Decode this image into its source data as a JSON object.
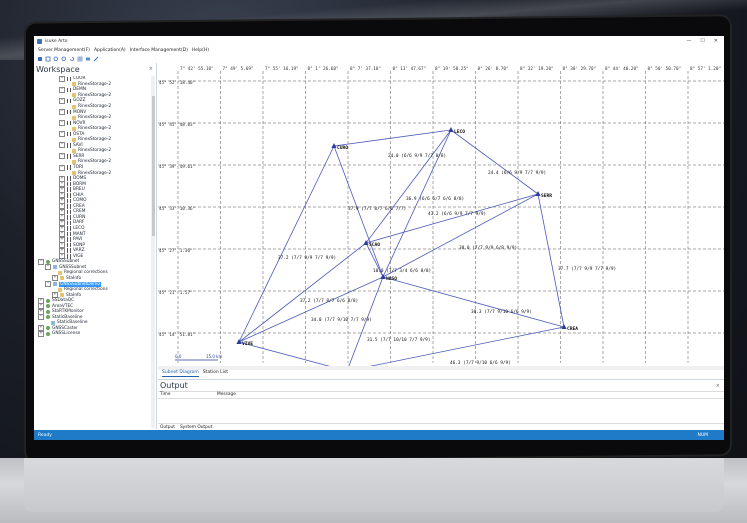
{
  "window": {
    "title": "isuke Arto",
    "min": "—",
    "max": "☐",
    "close": "✕"
  },
  "menu": [
    "Server Management(F)",
    "Application(A)",
    "Interface Management(D)",
    "Help(H)"
  ],
  "toolbar_icons": [
    "new-icon",
    "fit-icon",
    "zoom-in-icon",
    "zoom-out-icon",
    "refresh-icon",
    "grid-icon",
    "export-icon",
    "pen-icon"
  ],
  "workspace": {
    "title": "Workspace",
    "close": "×",
    "tree": [
      {
        "indent": 3,
        "kind": "station",
        "exp": "⊟",
        "label": "CUOR"
      },
      {
        "indent": 4,
        "kind": "leaf",
        "exp": "",
        "label": "RinexStorage-2"
      },
      {
        "indent": 3,
        "kind": "station",
        "exp": "⊟",
        "label": "DEMN"
      },
      {
        "indent": 4,
        "kind": "leaf",
        "exp": "",
        "label": "RinexStorage-2"
      },
      {
        "indent": 3,
        "kind": "station",
        "exp": "⊟",
        "label": "GOZZ"
      },
      {
        "indent": 4,
        "kind": "leaf",
        "exp": "",
        "label": "RinexStorage-2"
      },
      {
        "indent": 3,
        "kind": "station",
        "exp": "⊟",
        "label": "MONV"
      },
      {
        "indent": 4,
        "kind": "leaf",
        "exp": "",
        "label": "RinexStorage-2"
      },
      {
        "indent": 3,
        "kind": "station",
        "exp": "⊟",
        "label": "NOVR"
      },
      {
        "indent": 4,
        "kind": "leaf",
        "exp": "",
        "label": "RinexStorage-2"
      },
      {
        "indent": 3,
        "kind": "station",
        "exp": "⊟",
        "label": "OSTA"
      },
      {
        "indent": 4,
        "kind": "leaf",
        "exp": "",
        "label": "RinexStorage-2"
      },
      {
        "indent": 3,
        "kind": "station",
        "exp": "⊟",
        "label": "SAVI"
      },
      {
        "indent": 4,
        "kind": "leaf",
        "exp": "",
        "label": "RinexStorage-2"
      },
      {
        "indent": 3,
        "kind": "station",
        "exp": "⊟",
        "label": "SERR"
      },
      {
        "indent": 4,
        "kind": "leaf",
        "exp": "",
        "label": "RinexStorage-2"
      },
      {
        "indent": 3,
        "kind": "station",
        "exp": "⊟",
        "label": "TORI"
      },
      {
        "indent": 4,
        "kind": "leaf",
        "exp": "",
        "label": "RinexStorage-2"
      },
      {
        "indent": 3,
        "kind": "station",
        "exp": "⊞",
        "label": "DOMS"
      },
      {
        "indent": 3,
        "kind": "station",
        "exp": "⊞",
        "label": "BORM"
      },
      {
        "indent": 3,
        "kind": "station",
        "exp": "⊞",
        "label": "BREU"
      },
      {
        "indent": 3,
        "kind": "station",
        "exp": "⊞",
        "label": "CHIA"
      },
      {
        "indent": 3,
        "kind": "station",
        "exp": "⊞",
        "label": "COMO"
      },
      {
        "indent": 3,
        "kind": "station",
        "exp": "⊞",
        "label": "CREA"
      },
      {
        "indent": 3,
        "kind": "station",
        "exp": "⊞",
        "label": "CREM"
      },
      {
        "indent": 3,
        "kind": "station",
        "exp": "⊞",
        "label": "CURN"
      },
      {
        "indent": 3,
        "kind": "station",
        "exp": "⊞",
        "label": "DARF"
      },
      {
        "indent": 3,
        "kind": "station",
        "exp": "⊞",
        "label": "LECO"
      },
      {
        "indent": 3,
        "kind": "station",
        "exp": "⊞",
        "label": "MANT"
      },
      {
        "indent": 3,
        "kind": "station",
        "exp": "⊞",
        "label": "PAVI"
      },
      {
        "indent": 3,
        "kind": "station",
        "exp": "⊞",
        "label": "SONP"
      },
      {
        "indent": 3,
        "kind": "station",
        "exp": "⊞",
        "label": "VARZ"
      },
      {
        "indent": 3,
        "kind": "station",
        "exp": "⊞",
        "label": "VIGE"
      },
      {
        "indent": 0,
        "kind": "cloud",
        "exp": "⊟",
        "label": "GNSSSubnet"
      },
      {
        "indent": 1,
        "kind": "sub",
        "exp": "⊟",
        "label": "GNSSSubnet"
      },
      {
        "indent": 2,
        "kind": "leaf",
        "exp": "",
        "label": "Regional corrections"
      },
      {
        "indent": 2,
        "kind": "leaf",
        "exp": "⊞",
        "label": "StaInfo"
      },
      {
        "indent": 1,
        "kind": "sub",
        "exp": "⊟",
        "label": "GNSSSubnetDemo",
        "selected": true
      },
      {
        "indent": 2,
        "kind": "leaf",
        "exp": "",
        "label": "Regional corrections"
      },
      {
        "indent": 2,
        "kind": "leaf",
        "exp": "⊞",
        "label": "StaInfo"
      },
      {
        "indent": 0,
        "kind": "cloud",
        "exp": "⊞",
        "label": "SSDataQC"
      },
      {
        "indent": 0,
        "kind": "cloud",
        "exp": "⊞",
        "label": "AreaVTEC"
      },
      {
        "indent": 0,
        "kind": "cloud",
        "exp": "⊞",
        "label": "StaRTKMonitor"
      },
      {
        "indent": 0,
        "kind": "cloud",
        "exp": "⊟",
        "label": "StaticBaseline"
      },
      {
        "indent": 1,
        "kind": "sub",
        "exp": "",
        "label": "StaticBaseline"
      },
      {
        "indent": 0,
        "kind": "cloud",
        "exp": "⊞",
        "label": "GNSSCaster"
      },
      {
        "indent": 0,
        "kind": "cloud",
        "exp": "⊞",
        "label": "GNSSLicense"
      }
    ]
  },
  "diagram": {
    "lon_labels": [
      "7° 42' 55.10\"",
      "7° 49' 5.69\"",
      "7° 55' 16.19\"",
      "8° 1' 26.68\"",
      "8° 7' 37.18\"",
      "8° 13' 47.67\"",
      "8° 19' 58.25\"",
      "8° 26' 8.70\"",
      "8° 32' 19.20\"",
      "8° 38' 29.70\"",
      "8° 44' 40.20\"",
      "8° 50' 50.70\"",
      "8° 57' 1.20\"",
      "9° 3' 1"
    ],
    "lat_labels": [
      "45° 52' 18.40\"",
      "45° 45' 48.83\"",
      "45° 39' 49.61\"",
      "45° 33' 10.36\"",
      "45° 27' 1.36\"",
      "45° 21' 1.57\"",
      "45° 14' 51.81\"",
      "45° 8' 8.06"
    ],
    "stations": [
      {
        "id": "CURO",
        "label": "CURO"
      },
      {
        "id": "LECO",
        "label": "LECO"
      },
      {
        "id": "SERR",
        "label": "SERR"
      },
      {
        "id": "SCAO",
        "label": "SCAO"
      },
      {
        "id": "NOSO",
        "label": "NOSO"
      },
      {
        "id": "CREA",
        "label": "CREA"
      },
      {
        "id": "VIVE",
        "label": "VIVE"
      },
      {
        "id": "PAVI",
        "label": "PAVI"
      }
    ],
    "baselines": [
      {
        "from": "CURO",
        "to": "LECO",
        "label": "24.0 (6/6 9/9 7/7 8/8)"
      },
      {
        "from": "LECO",
        "to": "SERR",
        "label": "24.4 (6/6 9/9 7/7 9/9)"
      },
      {
        "from": "LECO",
        "to": "SCAO",
        "label": "36.9 (6/6 6/7 6/6 8/8)"
      },
      {
        "from": "LECO",
        "to": "NOSO",
        "label": "43.2 (6/6 9/9 7/7 9/9)"
      },
      {
        "from": "CURO",
        "to": "NOSO",
        "label": "37.9 (7/7 8/7 6/6 7/7)"
      },
      {
        "from": "SERR",
        "to": "SCAO",
        "label": "38.0 (7/7 9/9 6/8 9/9)"
      },
      {
        "from": "SERR",
        "to": "CREA",
        "label": "37.7 (7/7 9/9 7/7 9/9)"
      },
      {
        "from": "CURO",
        "to": "VIVE",
        "label": "37.2 (7/7 9/9 7/7 9/9)"
      },
      {
        "from": "SCAO",
        "to": "NOSO",
        "label": "10.0 (7/7 3/4 6/6 8/8)"
      },
      {
        "from": "VIVE",
        "to": "SCAO",
        "label": "37.2 (7/7 8/7 6/6 8/8)"
      },
      {
        "from": "VIVE",
        "to": "NOSO",
        "label": "34.0 (7/7 9/10 7/7 9/9)"
      },
      {
        "from": "NOSO",
        "to": "CREA",
        "label": "30.3 (7/7 9/10 6/6 9/9)"
      },
      {
        "from": "NOSO",
        "to": "PAVI",
        "label": "31.5 (7/7 10/10 7/7 9/9)"
      },
      {
        "from": "VIVE",
        "to": "PAVI",
        "label": "24.9 (7/7 10/10 7/7 9/9)"
      },
      {
        "from": "PAVI",
        "to": "CREA",
        "label": "46.3 (7/7 9/10 6/6 9/9)"
      },
      {
        "from": "SERR",
        "to": "NOSO",
        "label": ""
      }
    ],
    "scale": {
      "left": "0.0",
      "right": "15.0 km"
    }
  },
  "tabs": [
    "Subnet Diagram",
    "Station List"
  ],
  "output": {
    "title": "Output",
    "close": "×",
    "columns": [
      "Time",
      "Message"
    ],
    "tabs": [
      "Output",
      "System Output"
    ]
  },
  "status": {
    "ready": "Ready",
    "num": "NUM"
  }
}
